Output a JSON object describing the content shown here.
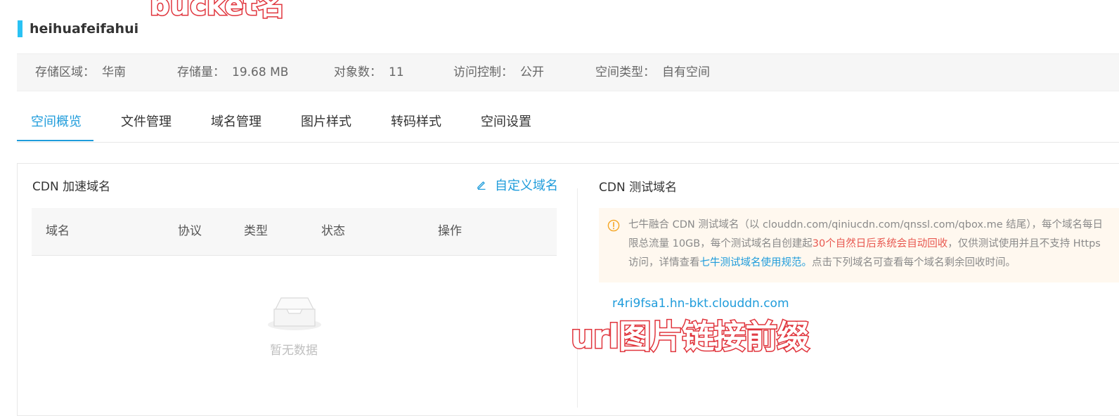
{
  "annotations": {
    "bucket_label": "bucket名",
    "url_label": "url图片链接前缀"
  },
  "bucket": {
    "name": "heihuafeifahui"
  },
  "info": [
    {
      "key": "存储区域：",
      "value": "华南"
    },
    {
      "key": "存储量：",
      "value": "19.68 MB"
    },
    {
      "key": "对象数：",
      "value": "11"
    },
    {
      "key": "访问控制：",
      "value": "公开"
    },
    {
      "key": "空间类型：",
      "value": "自有空间"
    }
  ],
  "tabs": [
    {
      "label": "空间概览",
      "active": true
    },
    {
      "label": "文件管理",
      "active": false
    },
    {
      "label": "域名管理",
      "active": false
    },
    {
      "label": "图片样式",
      "active": false
    },
    {
      "label": "转码样式",
      "active": false
    },
    {
      "label": "空间设置",
      "active": false
    }
  ],
  "cdn_domains": {
    "title": "CDN 加速域名",
    "custom_link": "自定义域名",
    "columns": [
      "域名",
      "协议",
      "类型",
      "状态",
      "操作"
    ],
    "empty_text": "暂无数据",
    "edit_icon": "edit-icon",
    "empty_icon": "empty-inbox-icon"
  },
  "test_domains": {
    "title": "CDN 测试域名",
    "notice": {
      "icon": "warning-icon",
      "text_part1": "七牛融合 CDN 测试域名（以 clouddn.com/qiniucdn.com/qnssl.com/qbox.me 结尾），每个域名每日限总流量 10GB，每个测试域名自创建起",
      "text_warning": "30个自然日后系统会自动回收",
      "text_part2": "，仅供测试使用并且不支持 Https 访问，详情查看",
      "text_link": "七牛测试域名使用规范。",
      "text_part3": "点击下列域名可查看每个域名剩余回收时间。"
    },
    "domain": "r4ri9fsa1.hn-bkt.clouddn.com"
  },
  "colors": {
    "accent": "#1f9cdb",
    "bucket_bar": "#2ac2f4",
    "annotation_outline": "#e0343c",
    "warning_text": "#e8574f",
    "notice_bg": "#fff8ef",
    "warning_icon": "#f5a623"
  }
}
